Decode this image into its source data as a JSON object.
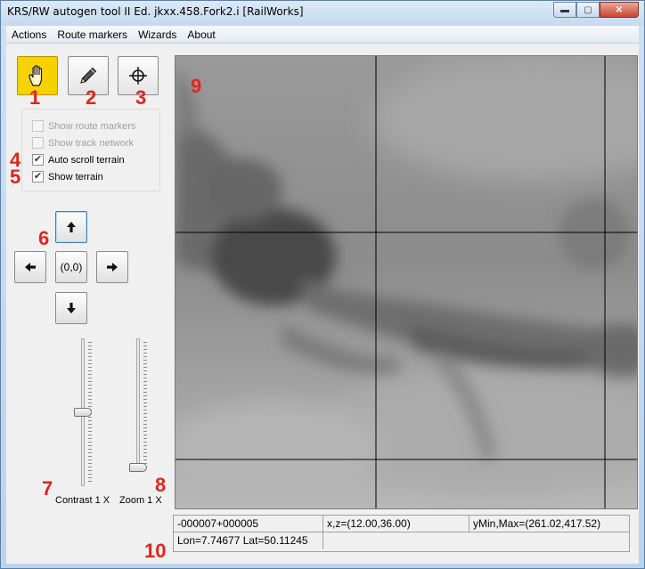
{
  "window": {
    "title": "KRS/RW autogen tool II Ed. jkxx.458.Fork2.i [RailWorks]",
    "minimize_glyph": "▬",
    "maximize_glyph": "▢",
    "close_glyph": "✕"
  },
  "menu": [
    {
      "label": "Actions"
    },
    {
      "label": "Route markers"
    },
    {
      "label": "Wizards"
    },
    {
      "label": "About"
    }
  ],
  "tools": {
    "pan": {
      "icon": "hand-icon",
      "active": true
    },
    "pencil": {
      "icon": "pencil-icon",
      "active": false
    },
    "target": {
      "icon": "crosshair-icon",
      "active": false
    }
  },
  "options": {
    "show_route_markers": {
      "label": "Show route markers",
      "checked": false,
      "enabled": false
    },
    "show_track_network": {
      "label": "Show track network",
      "checked": false,
      "enabled": false
    },
    "auto_scroll_terrain": {
      "label": "Auto scroll terrain",
      "checked": true,
      "enabled": true
    },
    "show_terrain": {
      "label": "Show terrain",
      "checked": true,
      "enabled": true
    }
  },
  "navigation": {
    "up_glyph": "🡑",
    "down_glyph": "🡓",
    "left_glyph": "🡐",
    "right_glyph": "🡒",
    "center_label": "(0,0)"
  },
  "contrast": {
    "label": "Contrast 1 X",
    "level": 0.5
  },
  "zoom": {
    "label": "Zoom 1 X",
    "level": 0.0
  },
  "status": {
    "tile": "-000007+000005",
    "xz": "x,z=(12.00,36.00)",
    "ymin_max": "yMin,Max=(261.02,417.52)",
    "lon_lat": "Lon=7.74677 Lat=50.11245"
  },
  "callouts": [
    "1",
    "2",
    "3",
    "4",
    "5",
    "6",
    "7",
    "8",
    "9",
    "10"
  ],
  "colors": {
    "active_tool": "#f5d200",
    "callout": "#e0251e"
  }
}
